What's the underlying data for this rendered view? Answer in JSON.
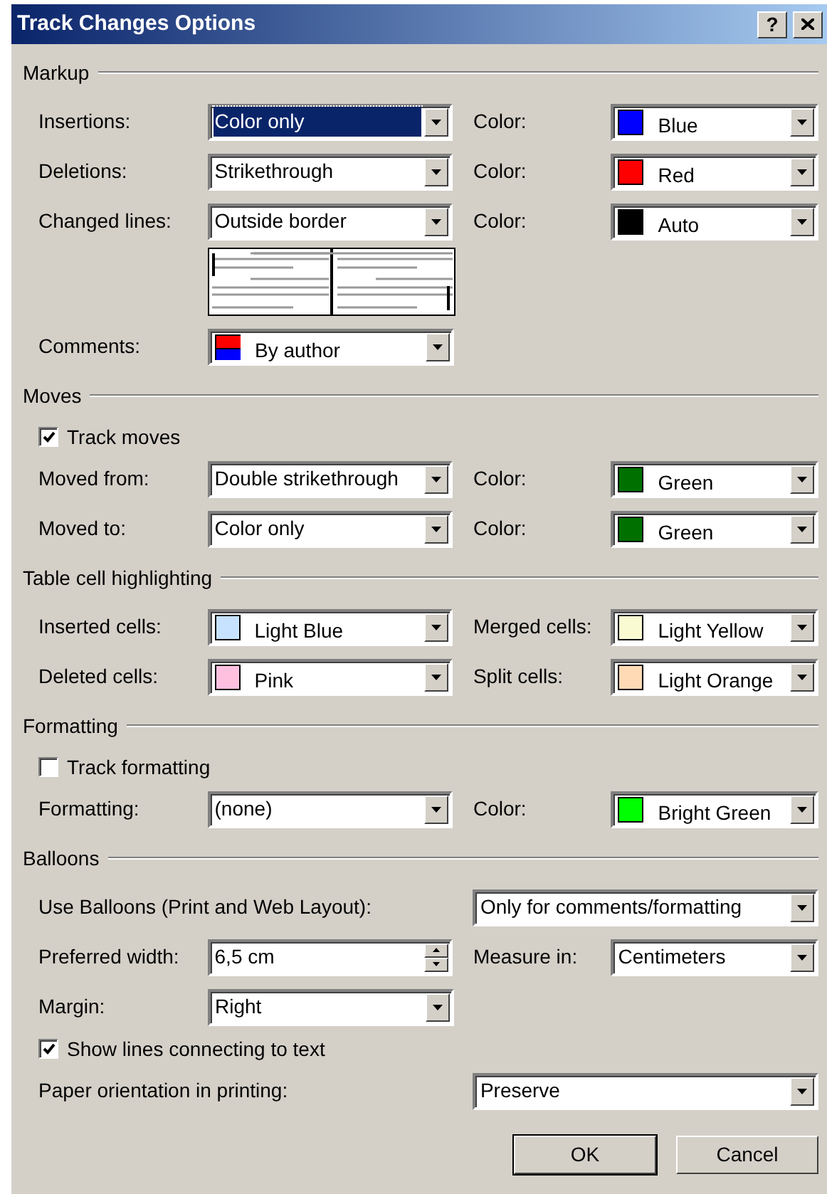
{
  "window": {
    "title": "Track Changes Options",
    "help_button": "?"
  },
  "sections": [
    {
      "title": "Markup",
      "rows": [
        {
          "kind": "fields",
          "fields": [
            {
              "kind": "plain",
              "label": "Insertions:",
              "value": "Color only",
              "focused": true
            },
            {
              "kind": "color",
              "label": "Color:",
              "value": "Blue",
              "color": "#0000ff",
              "focused": false
            }
          ]
        },
        {
          "kind": "fields",
          "fields": [
            {
              "kind": "plain",
              "label": "Deletions:",
              "value": "Strikethrough",
              "focused": false
            },
            {
              "kind": "color",
              "label": "Color:",
              "value": "Red",
              "color": "#ff0000",
              "focused": false
            }
          ]
        },
        {
          "kind": "fields",
          "fields": [
            {
              "kind": "plain",
              "label": "Changed lines:",
              "value": "Outside border",
              "focused": false
            },
            {
              "kind": "color",
              "label": "Color:",
              "value": "Auto",
              "color": "#000000",
              "focused": false
            }
          ]
        },
        {
          "kind": "preview"
        },
        {
          "kind": "fields",
          "fields": [
            {
              "kind": "author",
              "label": "Comments:",
              "value": "By author",
              "focused": false
            }
          ]
        }
      ]
    },
    {
      "title": "Moves",
      "rows": [
        {
          "kind": "checkbox",
          "label": "Track moves",
          "checked": true
        },
        {
          "kind": "fields",
          "fields": [
            {
              "kind": "plain",
              "label": "Moved from:",
              "value": "Double strikethrough",
              "focused": false
            },
            {
              "kind": "color",
              "label": "Color:",
              "value": "Green",
              "color": "#007000",
              "focused": false
            }
          ]
        },
        {
          "kind": "fields",
          "fields": [
            {
              "kind": "plain",
              "label": "Moved to:",
              "value": "Color only",
              "focused": false
            },
            {
              "kind": "color",
              "label": "Color:",
              "value": "Green",
              "color": "#007000",
              "focused": false
            }
          ]
        }
      ]
    },
    {
      "title": "Table cell highlighting",
      "rows": [
        {
          "kind": "fields",
          "fields": [
            {
              "kind": "color",
              "label": "Inserted cells:",
              "value": "Light Blue",
              "color": "#c6e2ff",
              "focused": false
            },
            {
              "kind": "color",
              "label": "Merged cells:",
              "value": "Light Yellow",
              "color": "#fafad2",
              "focused": false
            }
          ]
        },
        {
          "kind": "fields",
          "fields": [
            {
              "kind": "color",
              "label": "Deleted cells:",
              "value": "Pink",
              "color": "#ffc0e0",
              "focused": false
            },
            {
              "kind": "color",
              "label": "Split cells:",
              "value": "Light Orange",
              "color": "#ffdab4",
              "focused": false
            }
          ]
        }
      ]
    },
    {
      "title": "Formatting",
      "rows": [
        {
          "kind": "checkbox",
          "label": "Track formatting",
          "checked": false
        },
        {
          "kind": "fields",
          "fields": [
            {
              "kind": "plain",
              "label": "Formatting:",
              "value": "(none)",
              "focused": false
            },
            {
              "kind": "color",
              "label": "Color:",
              "value": "Bright Green",
              "color": "#00ff00",
              "focused": false
            }
          ]
        }
      ]
    },
    {
      "title": "Balloons",
      "rows": [
        {
          "kind": "wide",
          "fields": [
            {
              "kind": "plain",
              "label": "Use Balloons (Print and Web Layout):",
              "value": "Only for comments/formatting",
              "focused": false
            }
          ]
        },
        {
          "kind": "fields",
          "fields": [
            {
              "kind": "spin",
              "label": "Preferred width:",
              "value": "6,5 cm",
              "focused": false
            },
            {
              "kind": "plain",
              "label": "Measure in:",
              "value": "Centimeters",
              "focused": false
            }
          ]
        },
        {
          "kind": "fields",
          "fields": [
            {
              "kind": "plain",
              "label": "Margin:",
              "value": "Right",
              "focused": false
            }
          ]
        },
        {
          "kind": "checkbox",
          "label": "Show lines connecting to text",
          "checked": true
        },
        {
          "kind": "wide",
          "fields": [
            {
              "kind": "plain",
              "label": "Paper orientation in printing:",
              "value": "Preserve",
              "focused": false
            }
          ]
        }
      ]
    }
  ],
  "buttons": [
    {
      "label": "OK",
      "default": true
    },
    {
      "label": "Cancel",
      "default": false
    }
  ]
}
